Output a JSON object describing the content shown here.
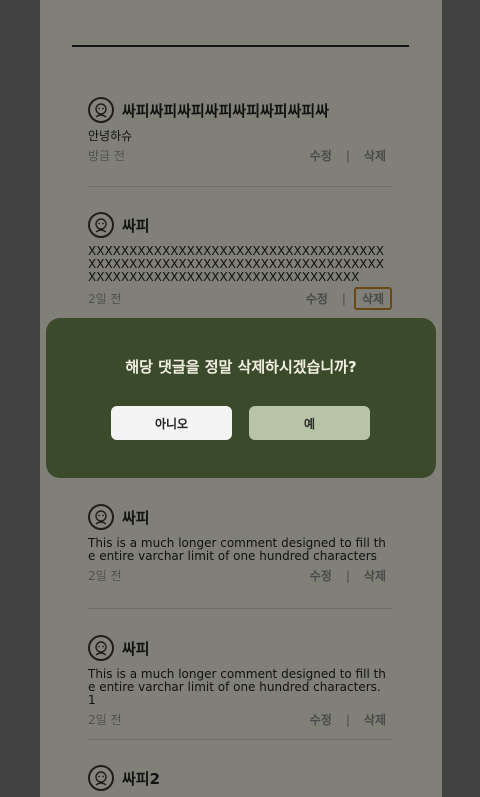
{
  "comments": [
    {
      "author": "싸피싸피싸피싸피싸피싸피싸피싸",
      "body": "안녕하슈",
      "time": "방금 전"
    },
    {
      "author": "싸피",
      "body": "XXXXXXXXXXXXXXXXXXXXXXXXXXXXXXXXXXXXXXXXXXXXXXXXXXXXXXXXXXXXXXXXXXXXXXXXXXXXXXXXXXXXXXXXXXXXXXXXXXXXXXXXX",
      "time": "2일 전"
    },
    {
      "author": "싸피",
      "body": "This is a much longer comment designed to fill the entire varchar limit of one hundred characters",
      "time": "2일 전"
    },
    {
      "author": "싸피",
      "body": "This is a much longer comment designed to fill the entire varchar limit of one hundred characters. 1",
      "time": "2일 전"
    },
    {
      "author": "싸피2",
      "body": "",
      "time": ""
    }
  ],
  "actions": {
    "edit": "수정",
    "separator": "|",
    "delete": "삭제"
  },
  "dialog": {
    "message": "해당 댓글을 정말 삭제하시겠습니까?",
    "no_label": "아니오",
    "yes_label": "예"
  },
  "colors": {
    "modal_bg": "#3c4a2c",
    "yes_button": "#b7c4a5",
    "delete_highlight": "#c48a2a"
  }
}
